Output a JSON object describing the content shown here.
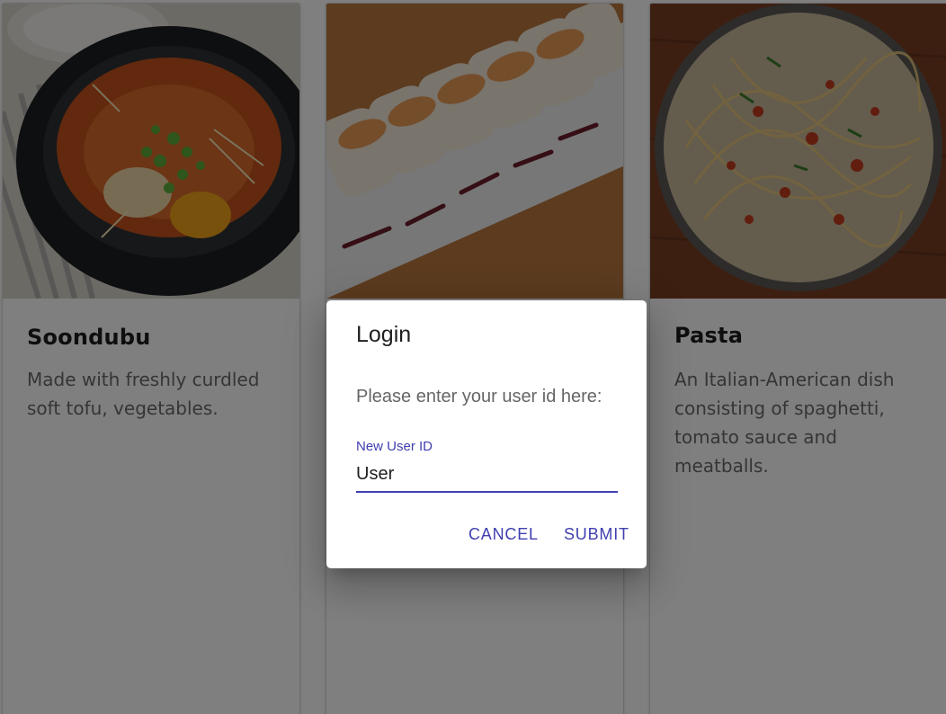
{
  "cards": [
    {
      "title": "Soondubu",
      "description": "Made with freshly curdled soft tofu, vegetables."
    },
    {
      "title": "",
      "description": ""
    },
    {
      "title": "Pasta",
      "description": "An Italian-American dish consisting of spaghetti, tomato sauce and meatballs."
    }
  ],
  "dialog": {
    "title": "Login",
    "prompt": "Please enter your user id here:",
    "field_label": "New User ID",
    "field_value": "User",
    "cancel_label": "CANCEL",
    "submit_label": "SUBMIT"
  },
  "colors": {
    "accent": "#3f3fb0",
    "backdrop": "rgba(0,0,0,0.5)"
  }
}
